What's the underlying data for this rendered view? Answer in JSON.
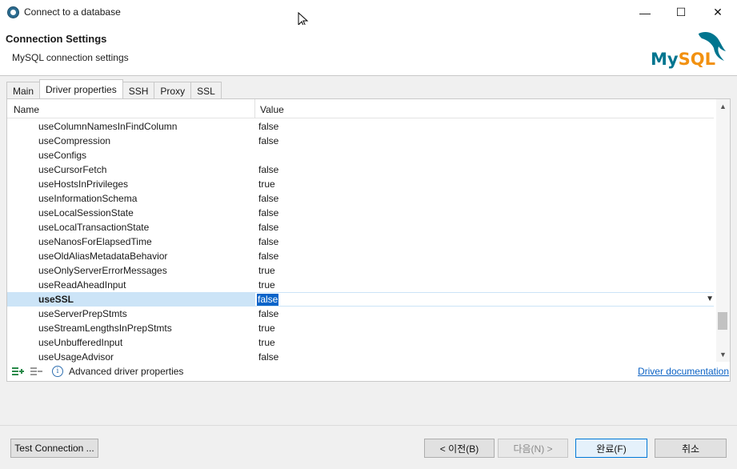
{
  "window": {
    "title": "Connect to a database",
    "minimize_glyph": "—",
    "maximize_glyph": "☐",
    "close_glyph": "✕"
  },
  "header": {
    "title": "Connection Settings",
    "subtitle": "MySQL connection settings",
    "logo_text_my": "My",
    "logo_text_sql": "SQL",
    "logo_colors": {
      "my": "#00758f",
      "sql": "#f29111"
    }
  },
  "tabs": [
    {
      "label": "Main",
      "active": false
    },
    {
      "label": "Driver properties",
      "active": true
    },
    {
      "label": "SSH",
      "active": false
    },
    {
      "label": "Proxy",
      "active": false
    },
    {
      "label": "SSL",
      "active": false
    }
  ],
  "table": {
    "col_name": "Name",
    "col_value": "Value",
    "rows": [
      {
        "name": "useColumnNamesInFindColumn",
        "value": "false"
      },
      {
        "name": "useCompression",
        "value": "false"
      },
      {
        "name": "useConfigs",
        "value": ""
      },
      {
        "name": "useCursorFetch",
        "value": "false"
      },
      {
        "name": "useHostsInPrivileges",
        "value": "true"
      },
      {
        "name": "useInformationSchema",
        "value": "false"
      },
      {
        "name": "useLocalSessionState",
        "value": "false"
      },
      {
        "name": "useLocalTransactionState",
        "value": "false"
      },
      {
        "name": "useNanosForElapsedTime",
        "value": "false"
      },
      {
        "name": "useOldAliasMetadataBehavior",
        "value": "false"
      },
      {
        "name": "useOnlyServerErrorMessages",
        "value": "true"
      },
      {
        "name": "useReadAheadInput",
        "value": "true"
      },
      {
        "name": "useSSL",
        "value": "false",
        "selected": true
      },
      {
        "name": "useServerPrepStmts",
        "value": "false"
      },
      {
        "name": "useStreamLengthsInPrepStmts",
        "value": "true"
      },
      {
        "name": "useUnbufferedInput",
        "value": "true"
      },
      {
        "name": "useUsageAdvisor",
        "value": "false"
      }
    ]
  },
  "tools": {
    "advanced_label": "Advanced driver properties",
    "doc_link": "Driver documentation",
    "add_icon": "add-property-icon",
    "remove_icon": "remove-property-icon",
    "info_icon": "info-icon"
  },
  "buttons": {
    "test_connection": "Test Connection ...",
    "back": "< 이전(B)",
    "next": "다음(N) >",
    "finish": "완료(F)",
    "cancel": "취소"
  }
}
